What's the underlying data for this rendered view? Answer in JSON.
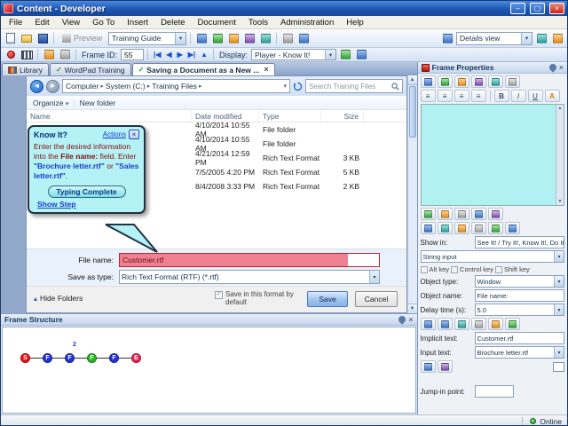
{
  "colors": {
    "titlebar": "#1d55b0",
    "callout_bg": "#b5f2f6",
    "highlight_red": "#ee8293",
    "textarea_cyan": "#b2f1f1",
    "online_green": "#1a9a1a"
  },
  "icons": {
    "dropdown": "▾",
    "breadcrumb_sep": "▸",
    "check": "✓",
    "close": "×",
    "minimize": "–",
    "maximize": "▢",
    "chevron_up": "▴",
    "scroll_up": "▲",
    "scroll_down": "▼",
    "nav_first": "|◀",
    "nav_prev": "◀",
    "nav_next": "▶",
    "nav_last": "▶|",
    "back_arrow": "◄",
    "forward_arrow": "►",
    "up_arrow": "▲",
    "align": "≡",
    "bold": "B",
    "italic": "I",
    "underline": "U",
    "highlighter": "A"
  },
  "window": {
    "title": "Content - Developer",
    "status_online": "Online"
  },
  "menu": {
    "items": [
      "File",
      "Edit",
      "View",
      "Go To",
      "Insert",
      "Delete",
      "Document",
      "Tools",
      "Administration",
      "Help"
    ]
  },
  "toolbar": {
    "preview": "Preview",
    "training_guide": "Training Guide",
    "details_view": "Details view"
  },
  "frame_bar": {
    "frame_id_label": "Frame ID:",
    "frame_id_value": "55",
    "display_label": "Display:",
    "display_value": "Player - Know It!"
  },
  "tabs": {
    "library": "Library",
    "wordpad": "WordPad Training",
    "active": "Saving a Document as a New ..."
  },
  "explorer": {
    "breadcrumb": [
      "Computer",
      "System (C:)",
      "Training Files"
    ],
    "search_placeholder": "Search Training Files",
    "organize": "Organize",
    "new_folder": "New folder",
    "columns": {
      "name": "Name",
      "date": "Date modified",
      "type": "Type",
      "size": "Size"
    },
    "rows": [
      {
        "date": "4/10/2014 10:55 AM",
        "type": "File folder",
        "size": ""
      },
      {
        "date": "4/10/2014 10:55 AM",
        "type": "File folder",
        "size": ""
      },
      {
        "date": "4/21/2014 12:59 PM",
        "type": "Rich Text Format",
        "size": "3 KB"
      },
      {
        "date": "7/5/2005 4:20 PM",
        "type": "Rich Text Format",
        "size": "5 KB"
      },
      {
        "date": "8/4/2008 3:33 PM",
        "type": "Rich Text Format",
        "size": "2 KB"
      }
    ],
    "file_name_label": "File name:",
    "file_name_value": "Customer.rtf",
    "save_type_label": "Save as type:",
    "save_type_value": "Rich Text Format (RTF) (*.rtf)",
    "default_format_checkbox": "Save in this format by default",
    "save_button": "Save",
    "cancel_button": "Cancel",
    "hide_folders": "Hide Folders"
  },
  "callout": {
    "title": "Know It?",
    "actions_link": "Actions",
    "body_pre": "Enter the desired information into the ",
    "body_field": "File name:",
    "body_mid": " field. Enter ",
    "file_option_1": "\"Brochure letter.rtf\"",
    "body_or": " or ",
    "file_option_2": "\"Sales letter.rtf\"",
    "body_end": ".",
    "typing_complete_button": "Typing Complete",
    "show_step_link": "Show Step"
  },
  "frame_structure": {
    "title": "Frame Structure",
    "nodes": [
      {
        "label": "S",
        "color": "#ee1111"
      },
      {
        "label": "F",
        "color": "#2233dd"
      },
      {
        "label": "F",
        "color": "#2233dd",
        "badge": "2"
      },
      {
        "label": "F",
        "color": "#22bb22"
      },
      {
        "label": "F",
        "color": "#2233dd"
      },
      {
        "label": "E",
        "color": "#ee2255"
      }
    ]
  },
  "properties": {
    "title": "Frame Properties",
    "show_in_label": "Show in:",
    "show_in_value": "See It! / Try It!, Know It!, Do It!",
    "input_type": "String input",
    "alt_key": "Alt key",
    "control_key": "Control key",
    "shift_key": "Shift key",
    "object_type_label": "Object type:",
    "object_type_value": "Window",
    "object_name_label": "Object name:",
    "object_name_value": "File name:",
    "delay_label": "Delay time (s):",
    "delay_value": "5.0",
    "implicit_label": "Implicit text:",
    "implicit_value": "Customer.rtf",
    "input_text_label": "Input text:",
    "input_text_value": "Brochure letter.rtf",
    "jump_label": "Jump-in point:"
  }
}
